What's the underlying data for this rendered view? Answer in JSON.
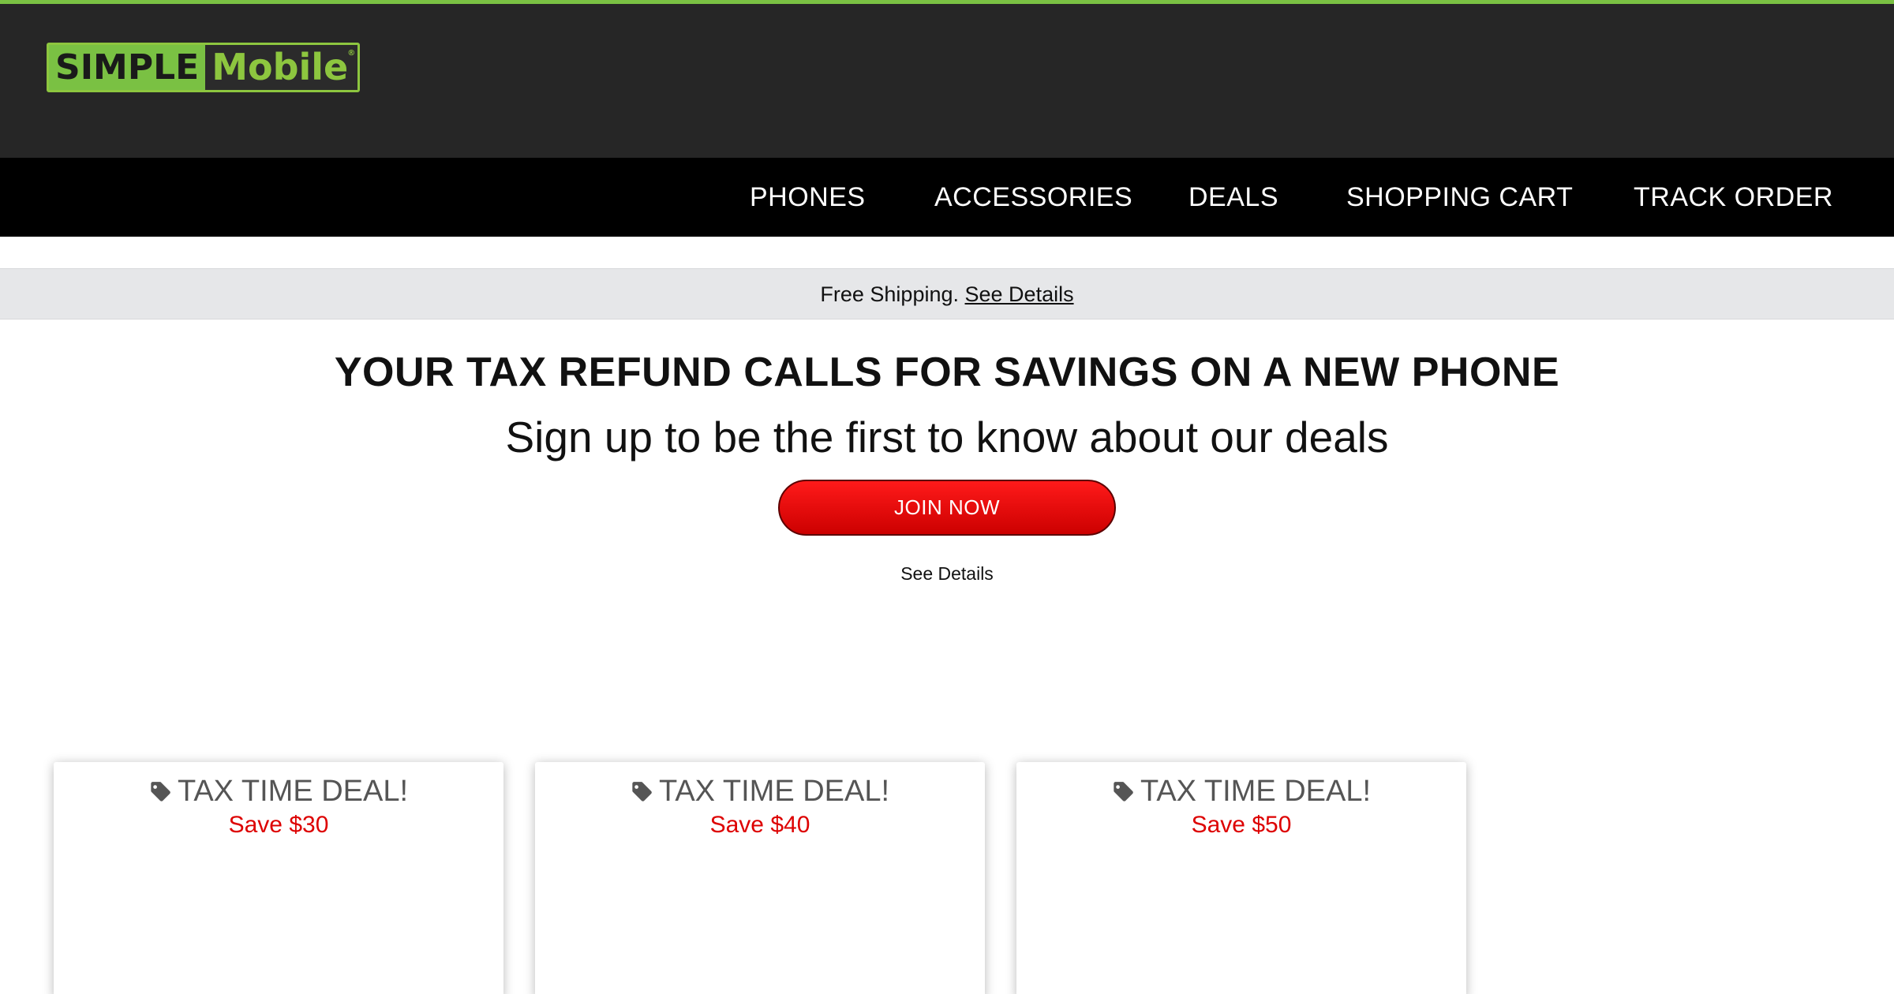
{
  "brand": {
    "logo_simple": "SIMPLE",
    "logo_mobile": "Mobile",
    "logo_reg": "®",
    "accent_color": "#7ac143"
  },
  "nav": {
    "items": [
      {
        "label": "PHONES"
      },
      {
        "label": "ACCESSORIES"
      },
      {
        "label": "DEALS"
      },
      {
        "label": "SHOPPING CART"
      },
      {
        "label": "TRACK ORDER"
      }
    ]
  },
  "promo": {
    "text": "Free Shipping.",
    "link": "See Details"
  },
  "hero": {
    "headline": "YOUR TAX REFUND CALLS FOR SAVINGS ON A NEW PHONE",
    "subheadline": "Sign up to be the first to know about our deals",
    "button_label": "JOIN NOW",
    "button_color": "#e00000",
    "details_link": "See Details"
  },
  "deals": [
    {
      "title": "TAX TIME DEAL!",
      "save": "Save $30",
      "icon": "tag-icon"
    },
    {
      "title": "TAX TIME DEAL!",
      "save": "Save $40",
      "icon": "tag-icon"
    },
    {
      "title": "TAX TIME DEAL!",
      "save": "Save $50",
      "icon": "tag-icon"
    }
  ]
}
